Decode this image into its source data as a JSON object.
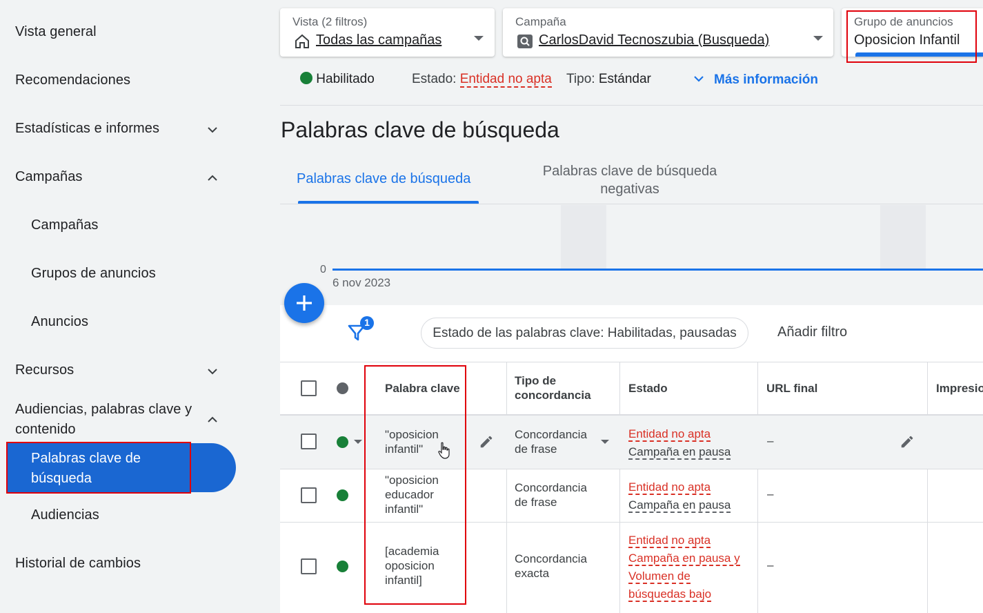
{
  "sidebar": {
    "items": [
      {
        "label": "Vista general"
      },
      {
        "label": "Recomendaciones"
      },
      {
        "label": "Estadísticas e informes"
      },
      {
        "label": "Campañas"
      },
      {
        "label": "Campañas"
      },
      {
        "label": "Grupos de anuncios"
      },
      {
        "label": "Anuncios"
      },
      {
        "label": "Recursos"
      },
      {
        "label": "Audiencias, palabras clave y contenido"
      },
      {
        "label": "Palabras clave de búsqueda"
      },
      {
        "label": "Audiencias"
      },
      {
        "label": "Historial de cambios"
      }
    ]
  },
  "header": {
    "view": {
      "label": "Vista (2 filtros)",
      "value": "Todas las campañas"
    },
    "campaign": {
      "label": "Campaña",
      "value": "CarlosDavid Tecnoszubia (Busqueda)"
    },
    "adgroup": {
      "label": "Grupo de anuncios",
      "value": "Oposicion Infantil"
    }
  },
  "status": {
    "enabled": "Habilitado",
    "estado_label": "Estado:",
    "estado_value": "Entidad no apta",
    "tipo_label": "Tipo:",
    "tipo_value": "Estándar",
    "more_info": "Más información"
  },
  "page": {
    "title": "Palabras clave de búsqueda",
    "tabs": [
      "Palabras clave de búsqueda",
      "Palabras clave de búsqueda negativas"
    ]
  },
  "chart": {
    "y_zero": "0",
    "date": "6 nov 2023"
  },
  "filters": {
    "count": "1",
    "chip": "Estado de las palabras clave: Habilitadas, pausadas",
    "add": "Añadir filtro"
  },
  "table": {
    "headers": {
      "keyword": "Palabra clave",
      "match_type": "Tipo de concordancia",
      "status": "Estado",
      "final_url": "URL final",
      "impressions": "Impresio"
    },
    "rows": [
      {
        "keyword_1": "\"oposicion",
        "keyword_2": "infantil\"",
        "match_1": "Concordancia",
        "match_2": "de frase",
        "status_1": "Entidad no apta",
        "status_2": "Campaña en pausa",
        "url": "–"
      },
      {
        "keyword_1": "\"oposicion",
        "keyword_2": "educador",
        "keyword_3": "infantil\"",
        "match_1": "Concordancia",
        "match_2": "de frase",
        "status_1": "Entidad no apta",
        "status_2": "Campaña en pausa",
        "url": "–"
      },
      {
        "keyword_1": "[academia",
        "keyword_2": "oposicion",
        "keyword_3": "infantil]",
        "match_1": "Concordancia",
        "match_2": "exacta",
        "status_1": "Entidad no apta",
        "status_2": "Campaña en pausa y",
        "status_3": "Volumen de",
        "status_4": "búsquedas bajo",
        "url": "–"
      }
    ]
  },
  "colors": {
    "accent": "#1a73e8",
    "active_nav": "#1a67d2",
    "enabled": "#188038",
    "error": "#d93025",
    "highlight": "#e0000a"
  }
}
